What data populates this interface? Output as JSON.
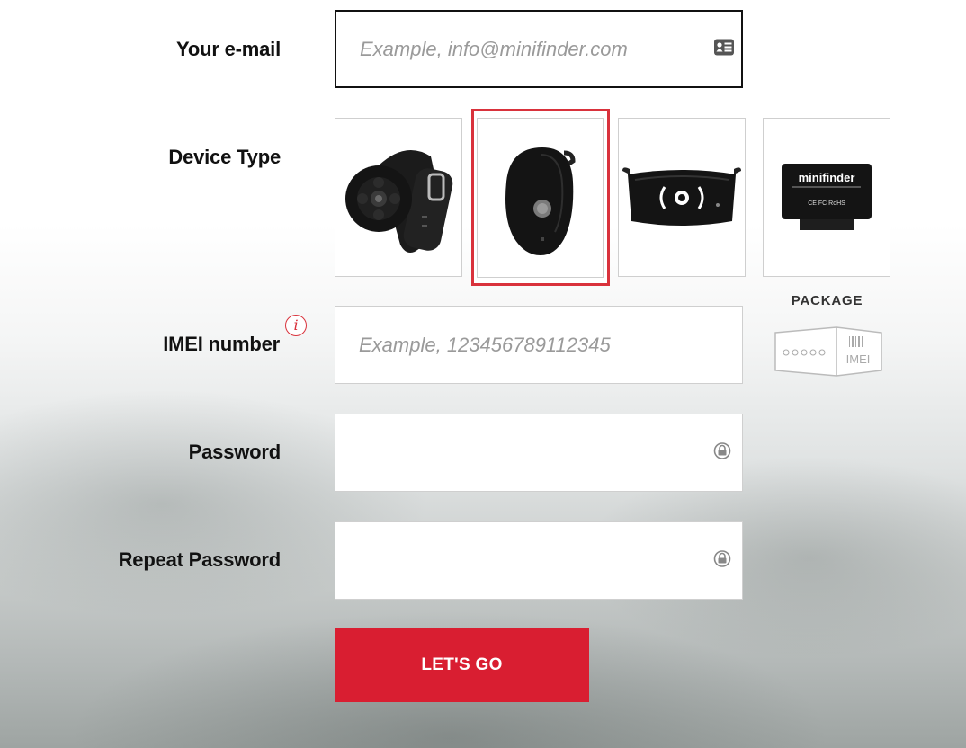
{
  "form": {
    "email": {
      "label": "Your e-mail",
      "placeholder": "Example, info@minifinder.com",
      "value": ""
    },
    "device_type": {
      "label": "Device Type",
      "devices": [
        {
          "name": "wristband tracker",
          "selected": false
        },
        {
          "name": "pendant tracker",
          "selected": true
        },
        {
          "name": "vehicle box tracker",
          "selected": false
        },
        {
          "name": "obd tracker",
          "selected": false,
          "brand_text": "minifinder",
          "cert_text": "CE FC RoHS"
        }
      ]
    },
    "imei": {
      "label": "IMEI number",
      "info_glyph": "i",
      "placeholder": "Example, 123456789112345",
      "value": "",
      "package_hint": {
        "title": "PACKAGE",
        "imei_text": "IMEI"
      }
    },
    "password": {
      "label": "Password",
      "value": ""
    },
    "repeat_password": {
      "label": "Repeat Password",
      "value": ""
    },
    "submit_label": "LET'S GO"
  },
  "colors": {
    "accent": "#d9323c",
    "button": "#d91e31",
    "label": "#111111"
  },
  "icons": [
    "contact-card-icon",
    "info-icon",
    "lock-icon",
    "package-barcode-icon"
  ]
}
